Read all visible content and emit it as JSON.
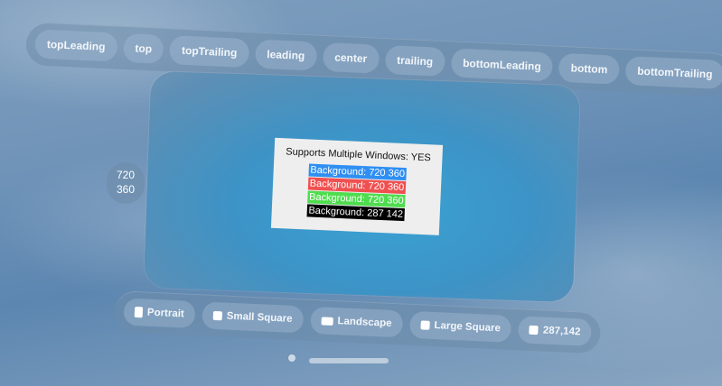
{
  "alignment_bar": {
    "items": [
      "topLeading",
      "top",
      "topTrailing",
      "leading",
      "center",
      "trailing",
      "bottomLeading",
      "bottom",
      "bottomTrailing"
    ]
  },
  "size_badge": {
    "width": "720",
    "height": "360"
  },
  "window": {
    "title": "Supports Multiple Windows: YES",
    "backgrounds": [
      {
        "label": "Background:",
        "w": "720",
        "h": "360",
        "color": "#2f8ff2",
        "text_color": "#ffffff"
      },
      {
        "label": "Background:",
        "w": "720",
        "h": "360",
        "color": "#f05050",
        "text_color": "#ffffff"
      },
      {
        "label": "Background:",
        "w": "720",
        "h": "360",
        "color": "#4fdc4f",
        "text_color": "#ffffff"
      },
      {
        "label": "Background:",
        "w": "287",
        "h": "142",
        "color": "#000000",
        "text_color": "#ffffff"
      }
    ]
  },
  "size_bar": {
    "items": [
      {
        "label": "Portrait",
        "icon": "portrait-square-icon"
      },
      {
        "label": "Small Square",
        "icon": "small-square-icon"
      },
      {
        "label": "Landscape",
        "icon": "landscape-square-icon"
      },
      {
        "label": "Large Square",
        "icon": "large-square-icon"
      },
      {
        "label": "287,142",
        "icon": "current-size-icon"
      }
    ]
  }
}
